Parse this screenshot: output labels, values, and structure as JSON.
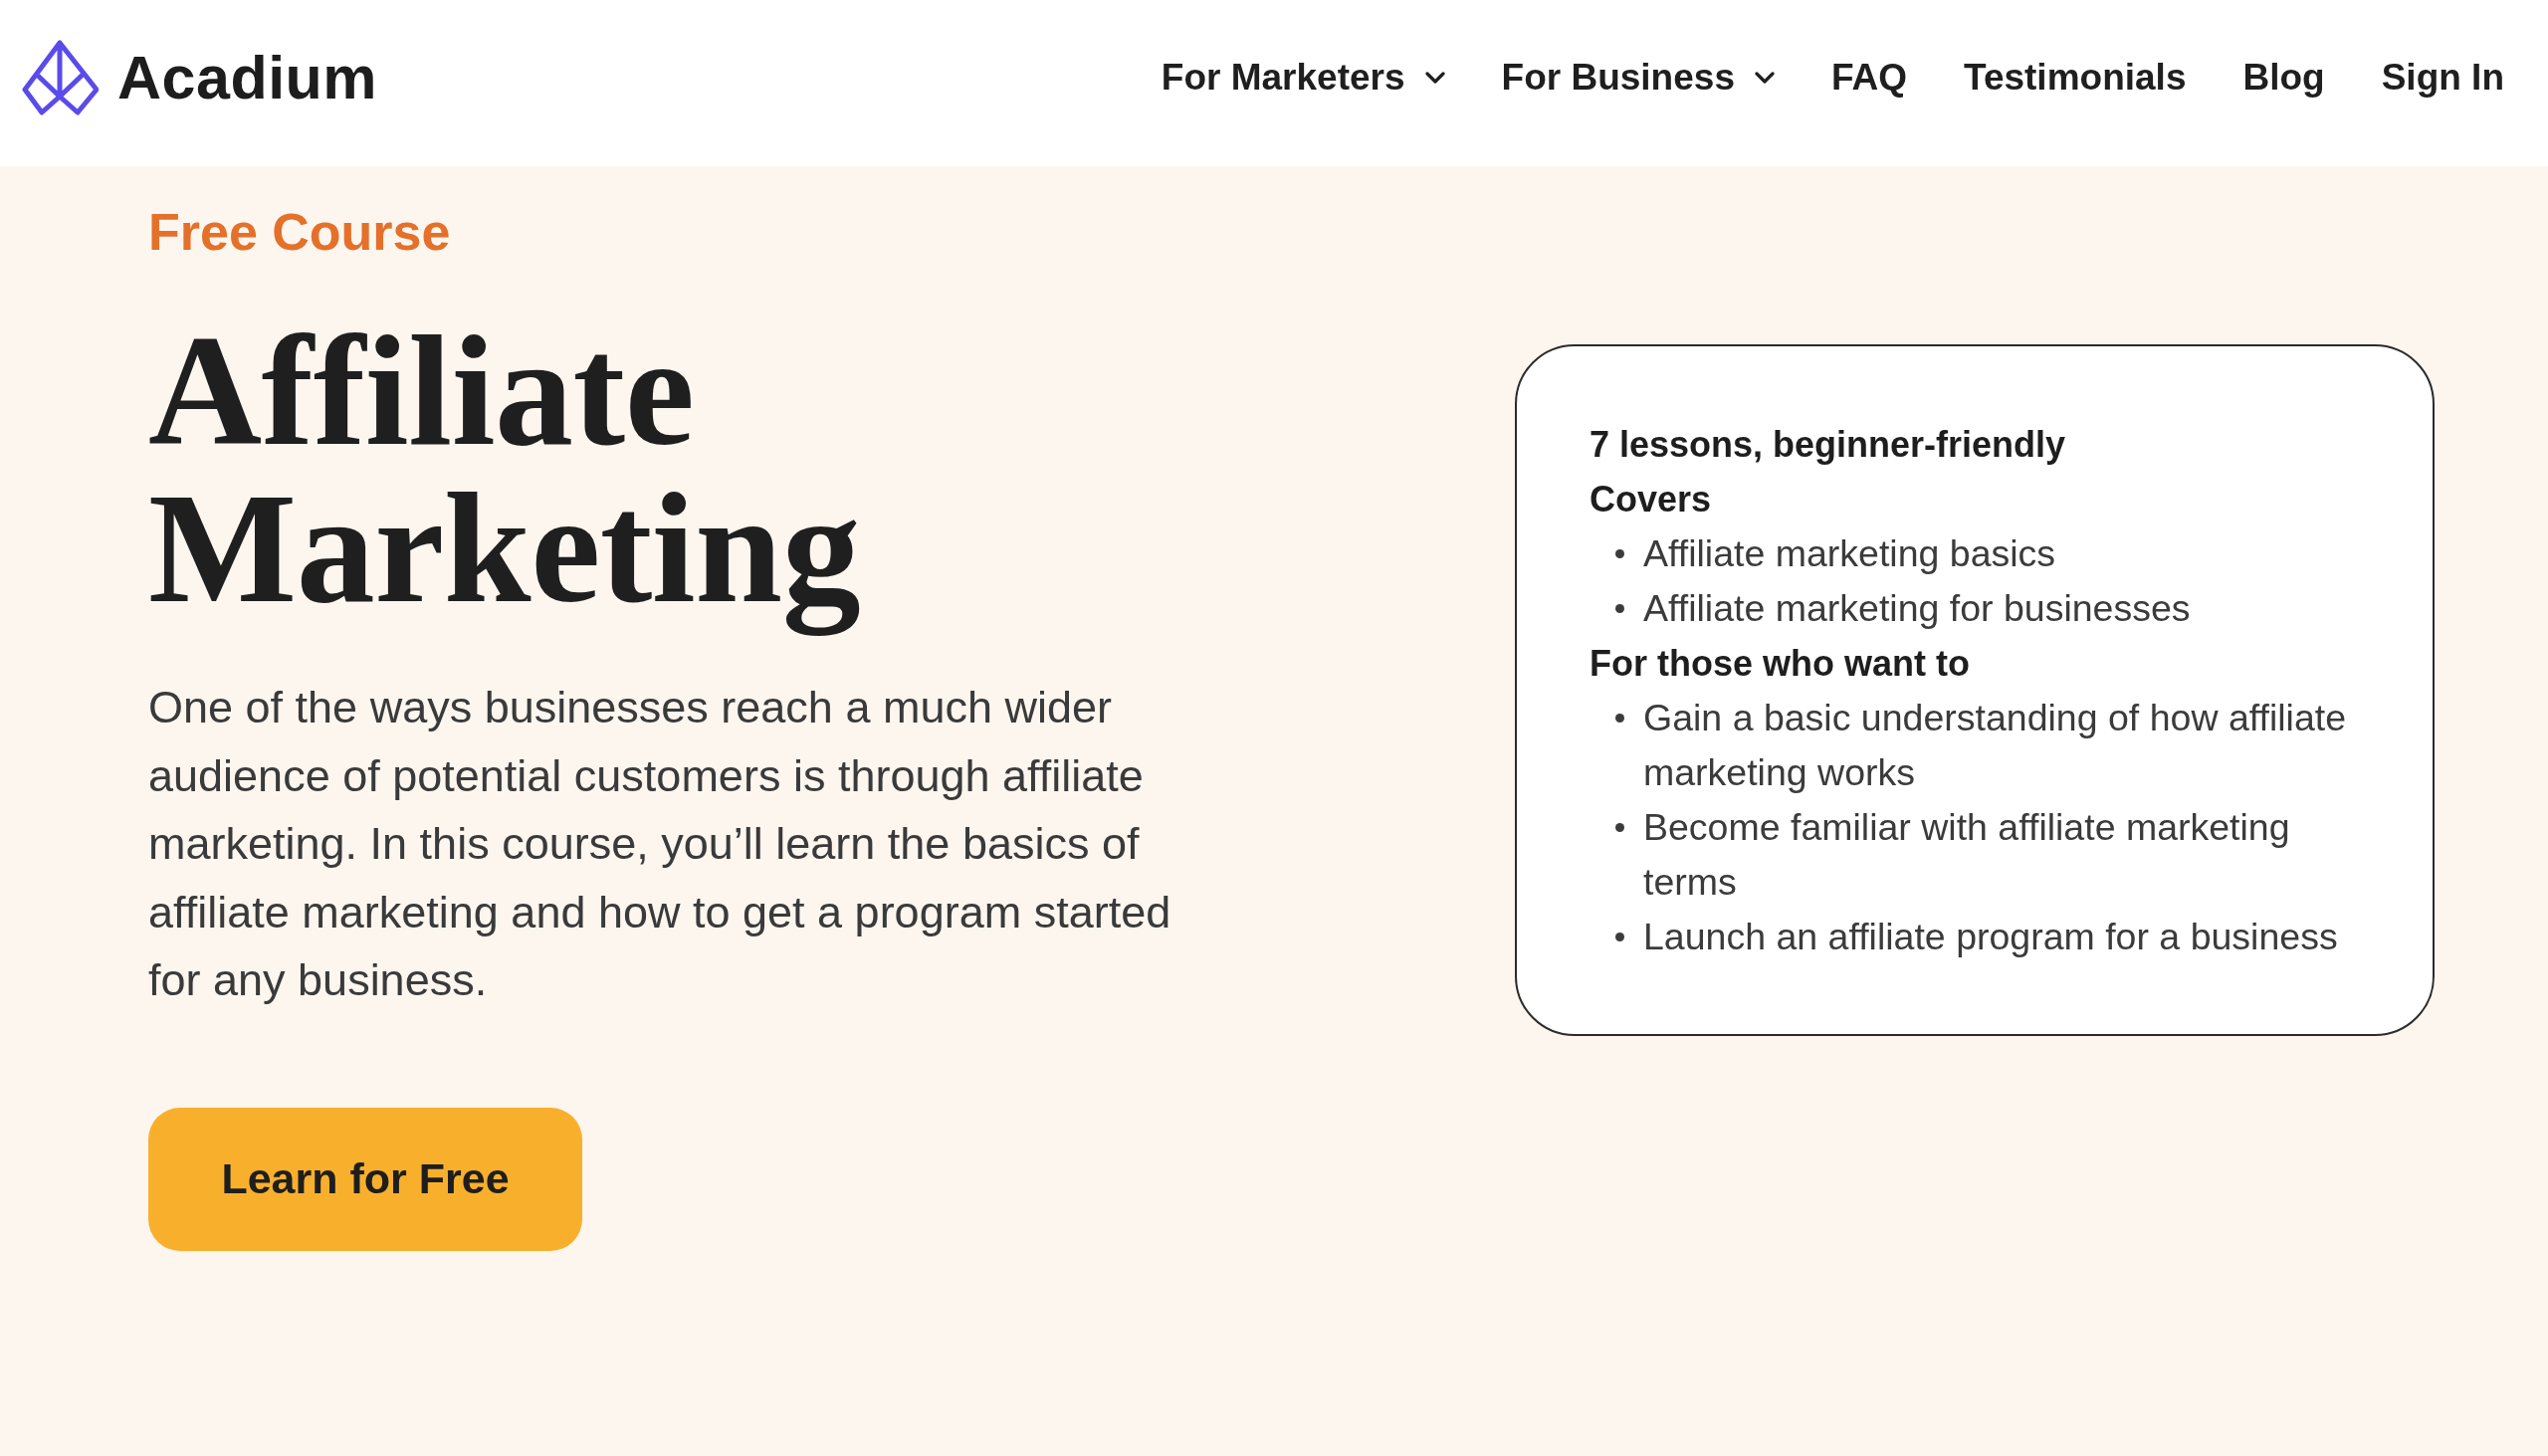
{
  "header": {
    "brand": "Acadium",
    "nav": [
      {
        "label": "For Marketers",
        "kind": "dropdown"
      },
      {
        "label": "For Business",
        "kind": "dropdown"
      },
      {
        "label": "FAQ",
        "kind": "link"
      },
      {
        "label": "Testimonials",
        "kind": "link"
      },
      {
        "label": "Blog",
        "kind": "link"
      },
      {
        "label": "Sign In",
        "kind": "link"
      }
    ]
  },
  "hero": {
    "eyebrow": "Free Course",
    "title": "Affiliate Marketing",
    "description": "One of the ways businesses reach a much wider audience of potential customers is through affiliate marketing. In this course, you’ll learn the basics of affiliate marketing and how to get a program started for any business.",
    "cta_button": "Learn for Free"
  },
  "course_card": {
    "summary": "7 lessons, beginner-friendly",
    "sections": [
      {
        "heading": "Covers",
        "items": [
          "Affiliate marketing basics",
          "Affiliate marketing for businesses"
        ]
      },
      {
        "heading": "For those who want to",
        "items": [
          "Gain a basic understanding of how affiliate marketing works",
          "Become familiar with affiliate marketing terms",
          "Launch an affiliate program for a business"
        ]
      }
    ]
  }
}
